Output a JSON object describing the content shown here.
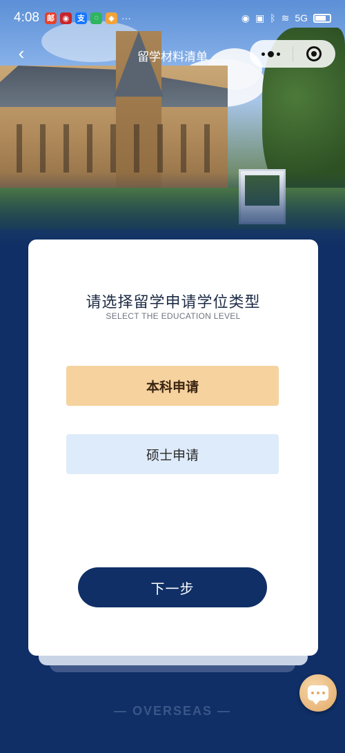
{
  "status_bar": {
    "time": "4:08",
    "app_icons": [
      {
        "name": "mail-app-icon",
        "glyph": "邮",
        "color": "#e8412c"
      },
      {
        "name": "bank-app-icon",
        "glyph": "◉",
        "color": "#c9252c"
      },
      {
        "name": "alipay-app-icon",
        "glyph": "支",
        "color": "#1677ff"
      },
      {
        "name": "chat-app-icon",
        "glyph": "◌",
        "color": "#2fb45f"
      },
      {
        "name": "notes-app-icon",
        "glyph": "◆",
        "color": "#f2a33a"
      }
    ],
    "more": "···",
    "network": "5G",
    "battery_level": 0.7
  },
  "nav": {
    "back": "‹",
    "title": "留学材料清单"
  },
  "card": {
    "title": "请选择留学申请学位类型",
    "subtitle": "SELECT THE EDUCATION LEVEL",
    "options": [
      {
        "label": "本科申请",
        "selected": true
      },
      {
        "label": "硕士申请",
        "selected": false
      }
    ],
    "next_button": "下一步"
  },
  "footer": {
    "brand": "— OVERSEAS —"
  },
  "colors": {
    "primary": "#0f2f66",
    "selected_option": "#f5d29e",
    "unselected_option": "#deebfa",
    "chat_button": "#e3a866"
  }
}
